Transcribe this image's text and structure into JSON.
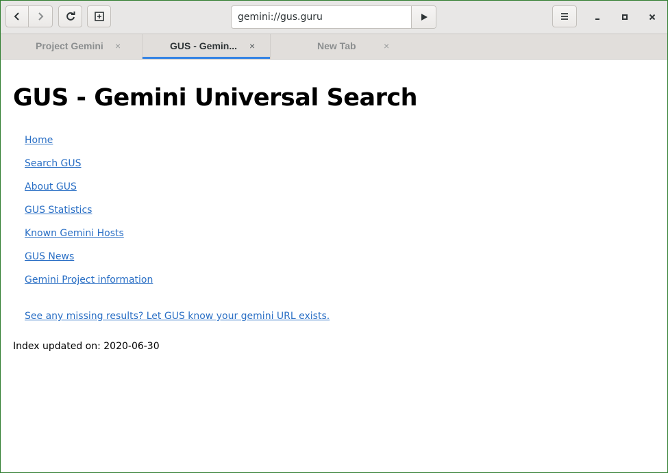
{
  "toolbar": {
    "back_icon": "chevron-left-icon",
    "forward_icon": "chevron-right-icon",
    "reload_icon": "reload-icon",
    "new_tab_icon": "new-tab-icon",
    "go_icon": "play-icon",
    "menu_icon": "hamburger-menu-icon"
  },
  "url": {
    "value": "gemini://gus.guru"
  },
  "window_controls": {
    "minimize": "minimize-icon",
    "maximize": "maximize-icon",
    "close": "close-icon"
  },
  "tabs": [
    {
      "label": "Project Gemini",
      "active": false,
      "close": "×"
    },
    {
      "label": "GUS - Gemin...",
      "active": true,
      "close": "×"
    },
    {
      "label": "New Tab",
      "active": false,
      "close": "×"
    }
  ],
  "page": {
    "title": "GUS - Gemini Universal Search",
    "links": [
      "Home",
      "Search GUS",
      "About GUS",
      "GUS Statistics",
      "Known Gemini Hosts",
      "GUS News",
      "Gemini Project information"
    ],
    "missing_link": "See any missing results? Let GUS know your gemini URL exists.",
    "index_updated": "Index updated on: 2020-06-30"
  },
  "colors": {
    "link": "#2a6fc5",
    "active_tab_indicator": "#3584e4",
    "window_border": "#2f7d2f"
  }
}
